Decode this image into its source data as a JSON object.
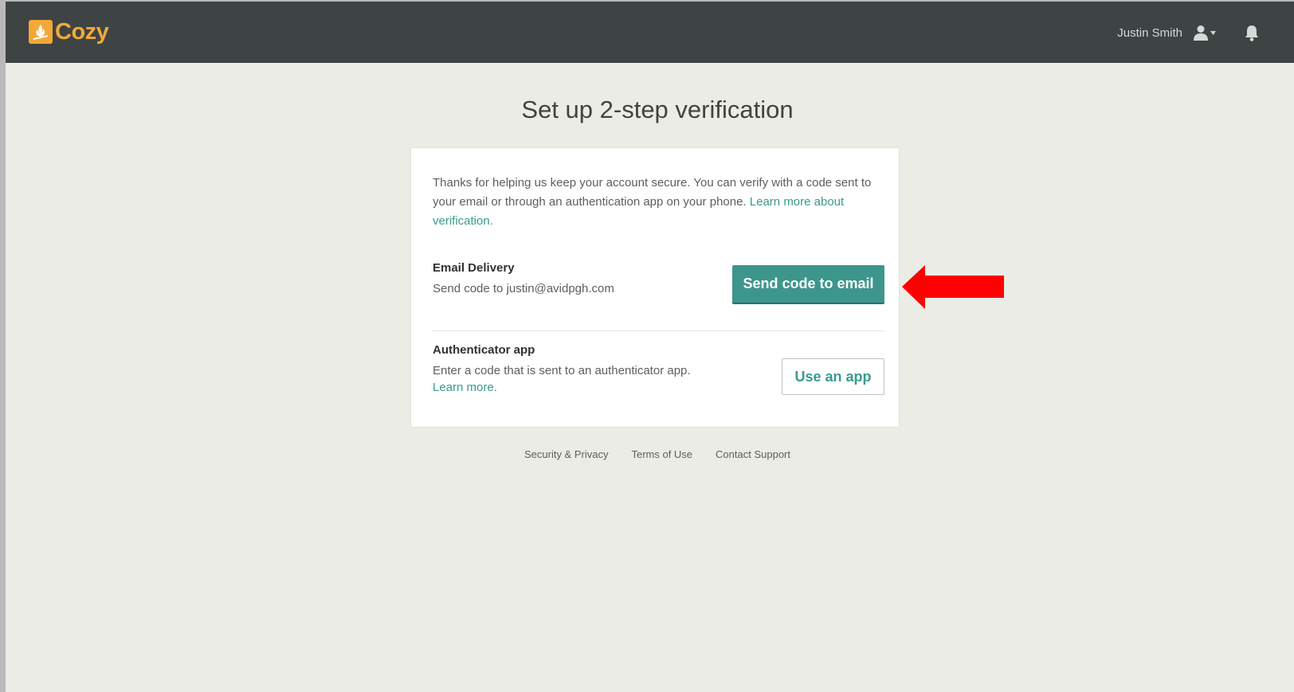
{
  "header": {
    "logo_text": "Cozy",
    "user_name": "Justin Smith",
    "icons": [
      "logo-icon",
      "user-icon",
      "chevron-down-icon",
      "bell-icon"
    ]
  },
  "main": {
    "title": "Set up 2-step verification",
    "intro_text": "Thanks for helping us keep your account secure. You can verify with a code sent to your email or through an authentication app on your phone. ",
    "intro_link": "Learn more about verification.",
    "email": {
      "title": "Email Delivery",
      "description": "Send code to justin@avidpgh.com",
      "button": "Send code to email"
    },
    "app": {
      "title": "Authenticator app",
      "description": "Enter a code that is sent to an authenticator app.",
      "link": "Learn more.",
      "button": "Use an app"
    }
  },
  "footer": {
    "links": [
      "Security & Privacy",
      "Terms of Use",
      "Contact Support"
    ]
  },
  "colors": {
    "topbar": "#3d4443",
    "brand": "#f2a83a",
    "accent": "#3d968c",
    "background": "#ecece6",
    "annotation_arrow": "#ff0000"
  }
}
